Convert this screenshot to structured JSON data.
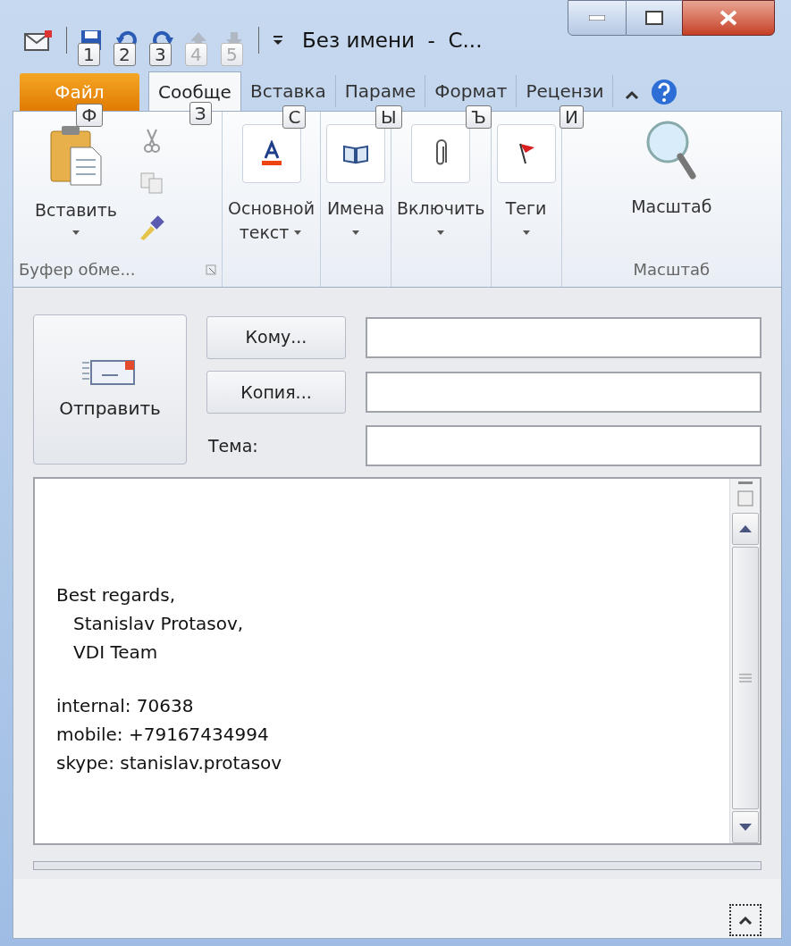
{
  "window": {
    "title": "Без имени  -  С..."
  },
  "quick_access": [
    {
      "kind": "save",
      "keytip": "1",
      "disabled": false
    },
    {
      "kind": "undo",
      "keytip": "2",
      "disabled": false
    },
    {
      "kind": "redo",
      "keytip": "3",
      "disabled": false
    },
    {
      "kind": "up",
      "keytip": "4",
      "disabled": true
    },
    {
      "kind": "down",
      "keytip": "5",
      "disabled": true
    }
  ],
  "tabs": [
    {
      "label": "Файл",
      "kind": "file",
      "keytip": "Ф",
      "selected": false
    },
    {
      "label": "Сообще",
      "kind": "tab",
      "keytip": "З",
      "selected": true
    },
    {
      "label": "Вставка",
      "kind": "tab",
      "keytip": "С",
      "selected": false
    },
    {
      "label": "Параме",
      "kind": "tab",
      "keytip": "Ы",
      "selected": false
    },
    {
      "label": "Формат",
      "kind": "tab",
      "keytip": "Ъ",
      "selected": false
    },
    {
      "label": "Рецензи",
      "kind": "tab",
      "keytip": "И",
      "selected": false
    }
  ],
  "ribbon": {
    "clipboard": {
      "paste": "Вставить",
      "label": "Буфер обме..."
    },
    "groups": [
      {
        "kind": "text",
        "label": "Основной",
        "label2": "текст"
      },
      {
        "kind": "names",
        "label": "Имена"
      },
      {
        "kind": "attach",
        "label": "Включить"
      },
      {
        "kind": "tags",
        "label": "Теги"
      }
    ],
    "zoom": {
      "button": "Масштаб",
      "label": "Масштаб"
    }
  },
  "header": {
    "send": "Отправить",
    "to": "Кому...",
    "cc": "Копия...",
    "subject": "Тема:"
  },
  "body": [
    [
      "Best regards,",
      "   Stanislav Protasov,",
      "   VDI Team"
    ],
    [
      "internal: 70638",
      "mobile: +79167434994",
      "skype: stanislav.protasov"
    ]
  ]
}
